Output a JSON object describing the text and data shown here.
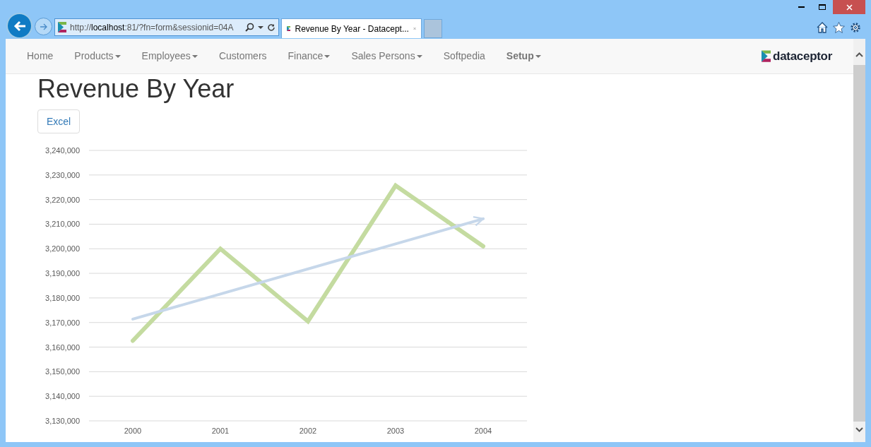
{
  "browser": {
    "address": {
      "prefix": "http://",
      "host": "localhost",
      "rest": ":81/?fn=form&sessionid=04A"
    },
    "tabs": [
      {
        "label": "Revenue By Year - Datacept...",
        "selected": true
      }
    ]
  },
  "navbar": {
    "items": [
      {
        "label": "Home",
        "dropdown": false,
        "bold": false
      },
      {
        "label": "Products",
        "dropdown": true,
        "bold": false
      },
      {
        "label": "Employees",
        "dropdown": true,
        "bold": false
      },
      {
        "label": "Customers",
        "dropdown": false,
        "bold": false
      },
      {
        "label": "Finance",
        "dropdown": true,
        "bold": false
      },
      {
        "label": "Sales Persons",
        "dropdown": true,
        "bold": false
      },
      {
        "label": "Softpedia",
        "dropdown": false,
        "bold": false
      },
      {
        "label": "Setup",
        "dropdown": true,
        "bold": true
      }
    ],
    "logo": "dataceptor"
  },
  "page": {
    "title": "Revenue By Year",
    "buttons": [
      "Excel"
    ],
    "chart_data": {
      "type": "line",
      "categories": [
        "2000",
        "2001",
        "2002",
        "2003",
        "2004"
      ],
      "series": [
        {
          "color": "#c4dba0",
          "values": [
            3162600,
            3200000,
            3170500,
            3225700,
            3201000
          ]
        },
        {
          "color": "#c6d7ea",
          "values": [
            3171400,
            null,
            null,
            null,
            3212200
          ]
        }
      ],
      "ylim": [
        3130000,
        3240000
      ],
      "grid": true,
      "yticks": [
        {
          "value": 3130000,
          "label": "3,130,000"
        },
        {
          "value": 3140000,
          "label": "3,140,000"
        },
        {
          "value": 3150000,
          "label": "3,150,000"
        },
        {
          "value": 3160000,
          "label": "3,160,000"
        },
        {
          "value": 3170000,
          "label": "3,170,000"
        },
        {
          "value": 3180000,
          "label": "3,180,000"
        },
        {
          "value": 3190000,
          "label": "3,190,000"
        },
        {
          "value": 3200000,
          "label": "3,200,000"
        },
        {
          "value": 3210000,
          "label": "3,210,000"
        },
        {
          "value": 3220000,
          "label": "3,220,000"
        },
        {
          "value": 3230000,
          "label": "3,230,000"
        },
        {
          "value": 3240000,
          "label": "3,240,000"
        }
      ]
    }
  }
}
